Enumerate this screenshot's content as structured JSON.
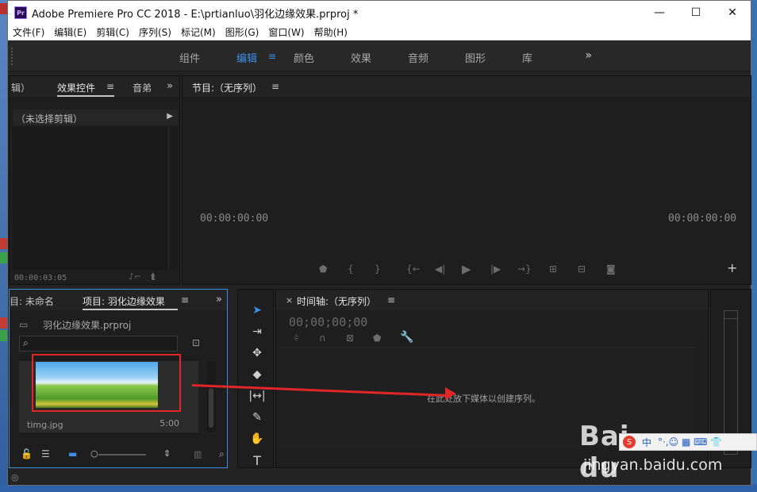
{
  "window": {
    "app_icon": "Pr",
    "title": "Adobe Premiere Pro CC 2018 - E:\\prtianluo\\羽化边缘效果.prproj *",
    "controls": [
      "—",
      "☐",
      "✕"
    ]
  },
  "menu": [
    "文件(F)",
    "编辑(E)",
    "剪辑(C)",
    "序列(S)",
    "标记(M)",
    "图形(G)",
    "窗口(W)",
    "帮助(H)"
  ],
  "workspaces": {
    "tabs": [
      "组件",
      "编辑",
      "颜色",
      "效果",
      "音频",
      "图形",
      "库"
    ],
    "active": "编辑",
    "menu_icon": "≡",
    "more": "»"
  },
  "source_panel": {
    "tab_prev": "辑）",
    "tab_active": "效果控件",
    "tab_next": "音弟",
    "hamb": "≡",
    "more": "»",
    "no_clip": "（未选择剪辑）",
    "timecode": "00:00:03:05"
  },
  "program_panel": {
    "title": "节目:（无序列）",
    "hamb": "≡",
    "timecode_left": "00:00:00:00",
    "timecode_right": "00:00:00:00",
    "add": "+"
  },
  "project_panel": {
    "tab_prev": "目: 未命名",
    "tab_active": "项目: 羽化边缘效果",
    "hamb": "≡",
    "more": "»",
    "project_file": "羽化边缘效果.prproj",
    "search_placeholder": "",
    "item_name": "timg.jpg",
    "item_duration": "5:00"
  },
  "timeline_panel": {
    "close": "×",
    "title": "时间轴:（无序列）",
    "hamb": "≡",
    "timecode": "00;00;00;00",
    "drop_hint": "在此处放下媒体以创建序列。"
  },
  "watermark": {
    "logo": "Bai du",
    "url": "jingyan.baidu.com"
  },
  "ime": {
    "logo": "S",
    "label": "中",
    "icons": "°·,☺ ▦ ⌨ 👕"
  }
}
